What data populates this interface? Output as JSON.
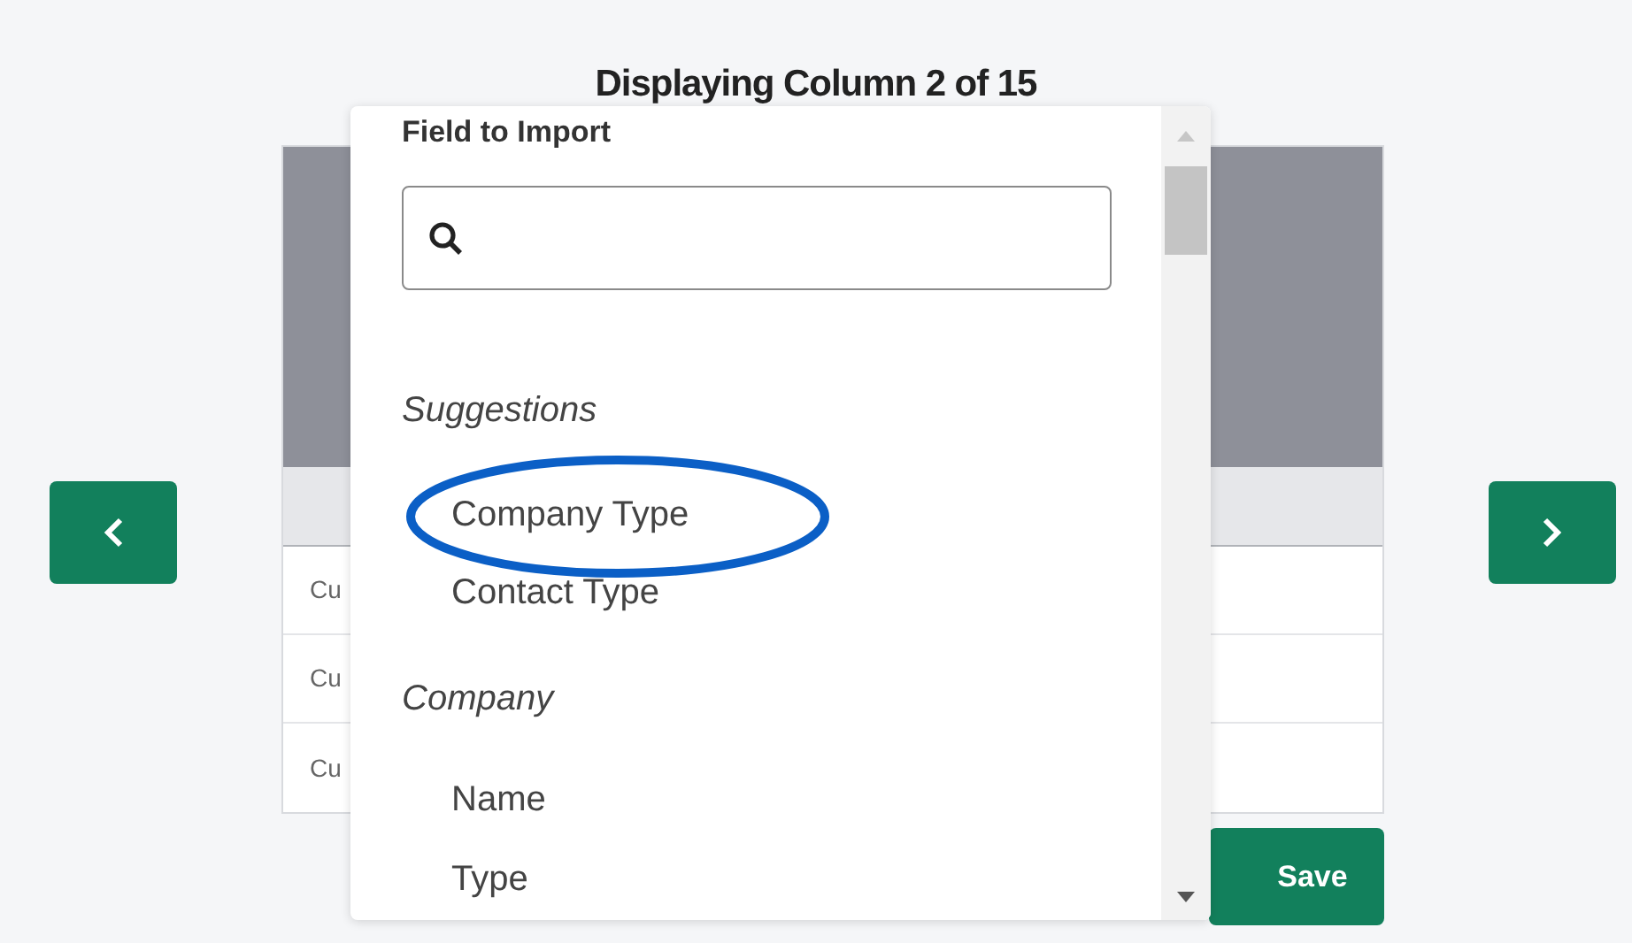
{
  "heading": "Displaying Column 2 of 15",
  "table": {
    "rows": [
      {
        "cell": "Cu"
      },
      {
        "cell": "Cu"
      },
      {
        "cell": "Cu"
      }
    ]
  },
  "save_button": "Save",
  "dropdown": {
    "title": "Field to Import",
    "groups": [
      {
        "label": "Suggestions",
        "items": [
          {
            "label": "Company Type",
            "circled": true
          },
          {
            "label": "Contact Type",
            "circled": false
          }
        ]
      },
      {
        "label": "Company",
        "items": [
          {
            "label": "Name",
            "circled": false
          },
          {
            "label": "Type",
            "circled": false
          }
        ]
      }
    ]
  }
}
